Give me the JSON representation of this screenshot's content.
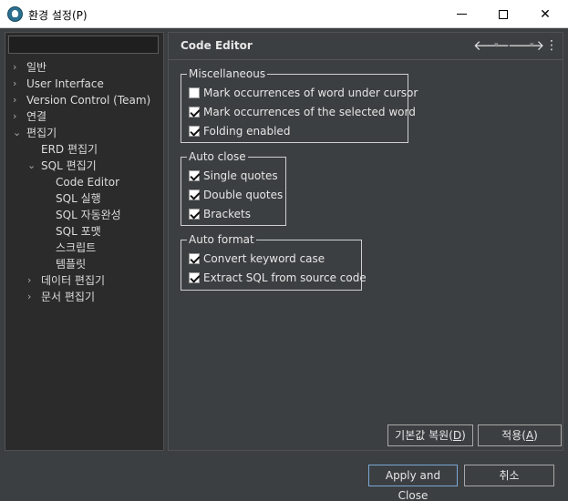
{
  "window": {
    "title": "환경 설정(P)",
    "min_glyph": "",
    "close_glyph": "✕"
  },
  "filter": {
    "value": "",
    "placeholder": ""
  },
  "tree": [
    {
      "label": "일반",
      "chev": "›"
    },
    {
      "label": "User Interface",
      "chev": "›"
    },
    {
      "label": "Version Control (Team)",
      "chev": "›"
    },
    {
      "label": "연결",
      "chev": "›"
    },
    {
      "label": "편집기",
      "chev": "⌄"
    },
    {
      "label": "ERD 편집기",
      "chev": ""
    },
    {
      "label": "SQL 편집기",
      "chev": "⌄"
    },
    {
      "label": "Code Editor",
      "chev": ""
    },
    {
      "label": "SQL 실행",
      "chev": ""
    },
    {
      "label": "SQL 자동완성",
      "chev": ""
    },
    {
      "label": "SQL 포맷",
      "chev": ""
    },
    {
      "label": "스크립트",
      "chev": ""
    },
    {
      "label": "템플릿",
      "chev": ""
    },
    {
      "label": "데이터 편집기",
      "chev": "›"
    },
    {
      "label": "문서 편집기",
      "chev": "›"
    }
  ],
  "page": {
    "title": "Code Editor",
    "nav_back": "🡐",
    "nav_forward": "🡒",
    "nav_dropdown": "▾",
    "menu": "⋮"
  },
  "groups": {
    "misc": {
      "legend": "Miscellaneous",
      "items": [
        {
          "label": "Mark occurrences of word under cursor",
          "checked": false
        },
        {
          "label": "Mark occurrences of the selected word",
          "checked": true
        },
        {
          "label": "Folding enabled",
          "checked": true
        }
      ]
    },
    "autoclose": {
      "legend": "Auto close",
      "items": [
        {
          "label": "Single quotes",
          "checked": true
        },
        {
          "label": "Double quotes",
          "checked": true
        },
        {
          "label": "Brackets",
          "checked": true
        }
      ]
    },
    "autoformat": {
      "legend": "Auto format",
      "items": [
        {
          "label": "Convert keyword case",
          "checked": true
        },
        {
          "label": "Extract SQL from source code",
          "checked": true
        }
      ]
    }
  },
  "buttons": {
    "restore_defaults": "기본값 복원",
    "restore_mnemonic": "D",
    "apply": "적용",
    "apply_mnemonic": "A",
    "apply_close": "Apply and Close",
    "cancel": "취소"
  }
}
